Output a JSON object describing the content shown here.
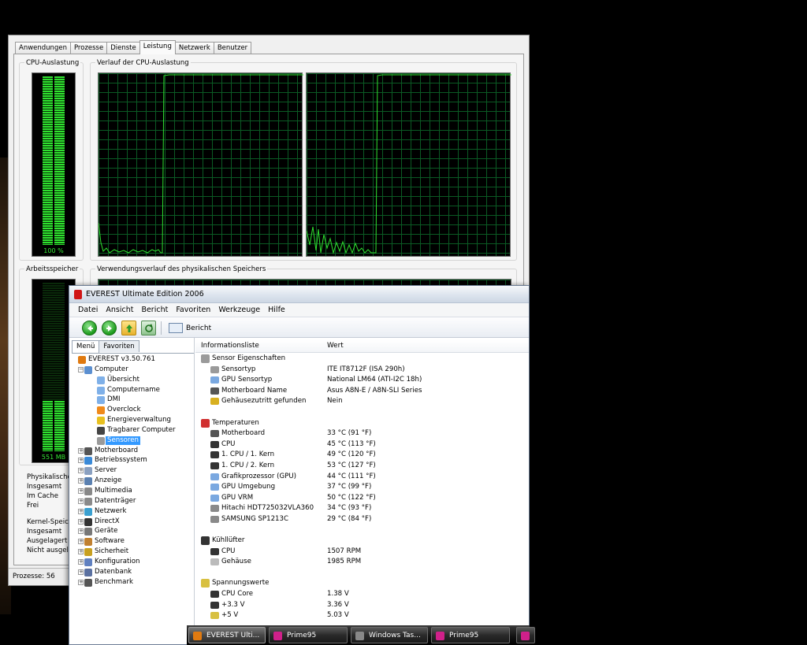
{
  "taskmanager": {
    "tabs": [
      "Anwendungen",
      "Prozesse",
      "Dienste",
      "Leistung",
      "Netzwerk",
      "Benutzer"
    ],
    "active_tab": "Leistung",
    "cpu_usage_title": "CPU-Auslastung",
    "cpu_usage_value": "100 %",
    "cpu_usage_fraction": 1.0,
    "cpu_history_title": "Verlauf der CPU-Auslastung",
    "memory_title": "Arbeitsspeicher",
    "memory_value": "551 MB",
    "memory_fraction": 0.3,
    "memory_history_title": "Verwendungsverlauf des physikalischen Speichers",
    "physical_memory_label": "Physikalische",
    "phys_total_label": "Insgesamt",
    "phys_cache_label": "Im Cache",
    "phys_free_label": "Frei",
    "kernel_label": "Kernel-Speic",
    "kernel_total_label": "Insgesamt",
    "kernel_paged_label": "Ausgelagert",
    "kernel_nonpaged_label": "Nicht ausgel",
    "status_processes": "Prozesse: 56",
    "graph_color": "#2fe02f"
  },
  "everest": {
    "title": "EVEREST Ultimate Edition 2006",
    "menu": [
      "Datei",
      "Ansicht",
      "Bericht",
      "Favoriten",
      "Werkzeuge",
      "Hilfe"
    ],
    "toolbar_report": "Bericht",
    "left_tabs": [
      "Menü",
      "Favoriten"
    ],
    "tree": [
      {
        "label": "EVEREST v3.50.761",
        "level": 0,
        "exp": "",
        "icon": "info-icon"
      },
      {
        "label": "Computer",
        "level": 1,
        "exp": "−",
        "icon": "computer-icon"
      },
      {
        "label": "Übersicht",
        "level": 2,
        "exp": "",
        "icon": "page-icon"
      },
      {
        "label": "Computername",
        "level": 2,
        "exp": "",
        "icon": "page-icon"
      },
      {
        "label": "DMI",
        "level": 2,
        "exp": "",
        "icon": "page-icon"
      },
      {
        "label": "Overclock",
        "level": 2,
        "exp": "",
        "icon": "flame-icon"
      },
      {
        "label": "Energieverwaltung",
        "level": 2,
        "exp": "",
        "icon": "power-icon"
      },
      {
        "label": "Tragbarer Computer",
        "level": 2,
        "exp": "",
        "icon": "laptop-icon"
      },
      {
        "label": "Sensoren",
        "level": 2,
        "exp": "",
        "icon": "sensor-icon",
        "selected": true
      },
      {
        "label": "Motherboard",
        "level": 1,
        "exp": "+",
        "icon": "motherboard-icon"
      },
      {
        "label": "Betriebssystem",
        "level": 1,
        "exp": "+",
        "icon": "windows-icon"
      },
      {
        "label": "Server",
        "level": 1,
        "exp": "+",
        "icon": "server-icon"
      },
      {
        "label": "Anzeige",
        "level": 1,
        "exp": "+",
        "icon": "monitor-icon"
      },
      {
        "label": "Multimedia",
        "level": 1,
        "exp": "+",
        "icon": "multimedia-icon"
      },
      {
        "label": "Datenträger",
        "level": 1,
        "exp": "+",
        "icon": "disk-icon"
      },
      {
        "label": "Netzwerk",
        "level": 1,
        "exp": "+",
        "icon": "network-icon"
      },
      {
        "label": "DirectX",
        "level": 1,
        "exp": "+",
        "icon": "directx-icon"
      },
      {
        "label": "Geräte",
        "level": 1,
        "exp": "+",
        "icon": "devices-icon"
      },
      {
        "label": "Software",
        "level": 1,
        "exp": "+",
        "icon": "software-icon"
      },
      {
        "label": "Sicherheit",
        "level": 1,
        "exp": "+",
        "icon": "shield-icon"
      },
      {
        "label": "Konfiguration",
        "level": 1,
        "exp": "+",
        "icon": "config-icon"
      },
      {
        "label": "Datenbank",
        "level": 1,
        "exp": "+",
        "icon": "database-icon"
      },
      {
        "label": "Benchmark",
        "level": 1,
        "exp": "+",
        "icon": "hourglass-icon"
      }
    ],
    "col_info": "Informationsliste",
    "col_value": "Wert",
    "rows": [
      {
        "type": "sec",
        "k": "Sensor Eigenschaften",
        "v": "",
        "icon": "sensor-icon"
      },
      {
        "type": "item",
        "k": "Sensortyp",
        "v": "ITE IT8712F  (ISA 290h)",
        "icon": "sensor-icon"
      },
      {
        "type": "item",
        "k": "GPU Sensortyp",
        "v": "National LM64  (ATI-I2C 18h)",
        "icon": "gpu-icon"
      },
      {
        "type": "item",
        "k": "Motherboard Name",
        "v": "Asus A8N-E / A8N-SLI Series",
        "icon": "motherboard-icon"
      },
      {
        "type": "item",
        "k": "Gehäusezutritt gefunden",
        "v": "Nein",
        "icon": "lock-icon"
      },
      {
        "type": "gap",
        "k": "",
        "v": ""
      },
      {
        "type": "sec",
        "k": "Temperaturen",
        "v": "",
        "icon": "thermometer-icon"
      },
      {
        "type": "item",
        "k": "Motherboard",
        "v": "33 °C  (91 °F)",
        "icon": "motherboard-icon"
      },
      {
        "type": "item",
        "k": "CPU",
        "v": "45 °C  (113 °F)",
        "icon": "cpu-icon"
      },
      {
        "type": "item",
        "k": "1. CPU / 1. Kern",
        "v": "49 °C  (120 °F)",
        "icon": "cpu-icon"
      },
      {
        "type": "item",
        "k": "1. CPU / 2. Kern",
        "v": "53 °C  (127 °F)",
        "icon": "cpu-icon"
      },
      {
        "type": "item",
        "k": "Grafikprozessor (GPU)",
        "v": "44 °C  (111 °F)",
        "icon": "gpu-icon"
      },
      {
        "type": "item",
        "k": "GPU Umgebung",
        "v": "37 °C  (99 °F)",
        "icon": "gpu-icon"
      },
      {
        "type": "item",
        "k": "GPU VRM",
        "v": "50 °C  (122 °F)",
        "icon": "gpu-icon"
      },
      {
        "type": "item",
        "k": "Hitachi HDT725032VLA360",
        "v": "34 °C  (93 °F)",
        "icon": "disk-icon"
      },
      {
        "type": "item",
        "k": "SAMSUNG SP1213C",
        "v": "29 °C  (84 °F)",
        "icon": "disk-icon"
      },
      {
        "type": "gap",
        "k": "",
        "v": ""
      },
      {
        "type": "sec",
        "k": "Kühllüfter",
        "v": "",
        "icon": "fan-icon"
      },
      {
        "type": "item",
        "k": "CPU",
        "v": "1507 RPM",
        "icon": "cpu-icon"
      },
      {
        "type": "item",
        "k": "Gehäuse",
        "v": "1985 RPM",
        "icon": "case-icon"
      },
      {
        "type": "gap",
        "k": "",
        "v": ""
      },
      {
        "type": "sec",
        "k": "Spannungswerte",
        "v": "",
        "icon": "voltage-icon"
      },
      {
        "type": "item",
        "k": "CPU Core",
        "v": "1.38 V",
        "icon": "cpu-icon"
      },
      {
        "type": "item",
        "k": "+3.3 V",
        "v": "3.36 V",
        "icon": "cpu-icon"
      },
      {
        "type": "item",
        "k": "+5 V",
        "v": "5.03 V",
        "icon": "voltage-icon"
      }
    ]
  },
  "taskbar": {
    "items": [
      {
        "label": "EVEREST Ulti...",
        "icon": "everest-icon",
        "active": true
      },
      {
        "label": "Prime95",
        "icon": "prime95-icon",
        "active": false
      },
      {
        "label": "Windows Tas...",
        "icon": "taskmanager-icon",
        "active": false
      },
      {
        "label": "Prime95",
        "icon": "prime95-icon",
        "active": false
      },
      {
        "label": "",
        "icon": "prime95-icon",
        "active": false
      }
    ]
  },
  "colors": {
    "selection": "#3399ff",
    "graph_green": "#2fe02f",
    "grid_green": "#0b5a24"
  }
}
